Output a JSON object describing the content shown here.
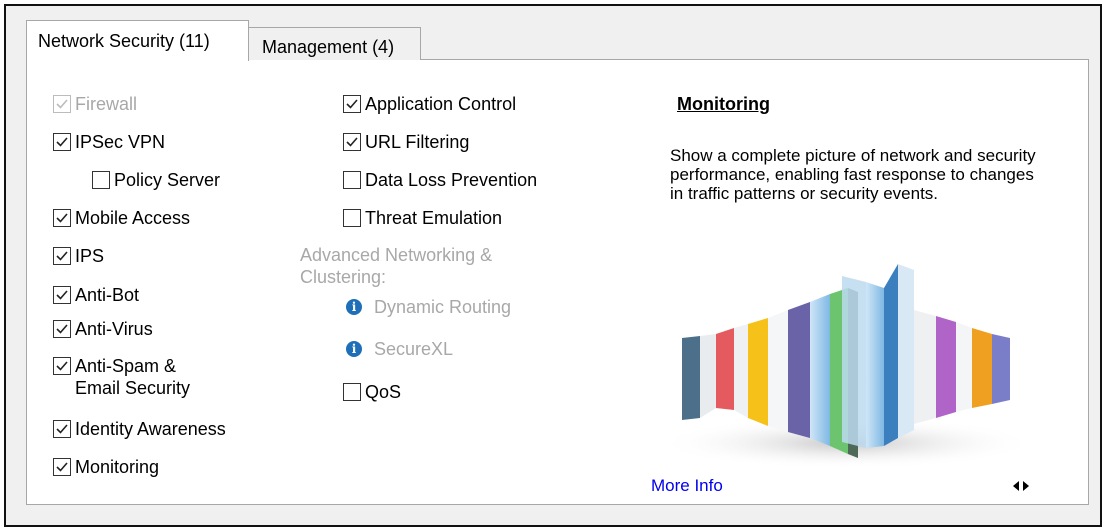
{
  "tabs": [
    {
      "label": "Network Security (11)",
      "active": true
    },
    {
      "label": "Management (4)",
      "active": false
    }
  ],
  "column1": [
    {
      "label": "Firewall",
      "checked": true,
      "enabled": false
    },
    {
      "label": "IPSec VPN",
      "checked": true,
      "enabled": true
    },
    {
      "label": "Policy Server",
      "checked": false,
      "enabled": true
    },
    {
      "label": "Mobile Access",
      "checked": true,
      "enabled": true
    },
    {
      "label": "IPS",
      "checked": true,
      "enabled": true
    },
    {
      "label": "Anti-Bot",
      "checked": true,
      "enabled": true
    },
    {
      "label": "Anti-Virus",
      "checked": true,
      "enabled": true
    },
    {
      "label_lines": [
        "Anti-Spam &",
        "Email Security"
      ],
      "checked": true,
      "enabled": true
    },
    {
      "label": "Identity Awareness",
      "checked": true,
      "enabled": true
    },
    {
      "label": "Monitoring",
      "checked": true,
      "enabled": true
    }
  ],
  "column2": [
    {
      "label": "Application Control",
      "checked": true,
      "enabled": true
    },
    {
      "label": "URL Filtering",
      "checked": true,
      "enabled": true
    },
    {
      "label": "Data Loss Prevention",
      "checked": false,
      "enabled": true
    },
    {
      "label": "Threat Emulation",
      "checked": false,
      "enabled": true
    }
  ],
  "advanced": {
    "group_label_lines": [
      "Advanced Networking &",
      "Clustering:"
    ],
    "info_items": [
      {
        "label": "Dynamic Routing",
        "icon": "info-icon"
      },
      {
        "label": "SecureXL",
        "icon": "info-icon"
      }
    ],
    "qos": {
      "label": "QoS",
      "checked": false,
      "enabled": true
    }
  },
  "description": {
    "title": "Monitoring",
    "text": "Show a complete picture of network and security performance, enabling fast response to changes in traffic patterns or security events.",
    "more_info_label": "More Info"
  },
  "colors": {
    "accent_link": "#0000ee",
    "info_icon": "#1f6fb8",
    "disabled_text": "#a8a8a8"
  }
}
